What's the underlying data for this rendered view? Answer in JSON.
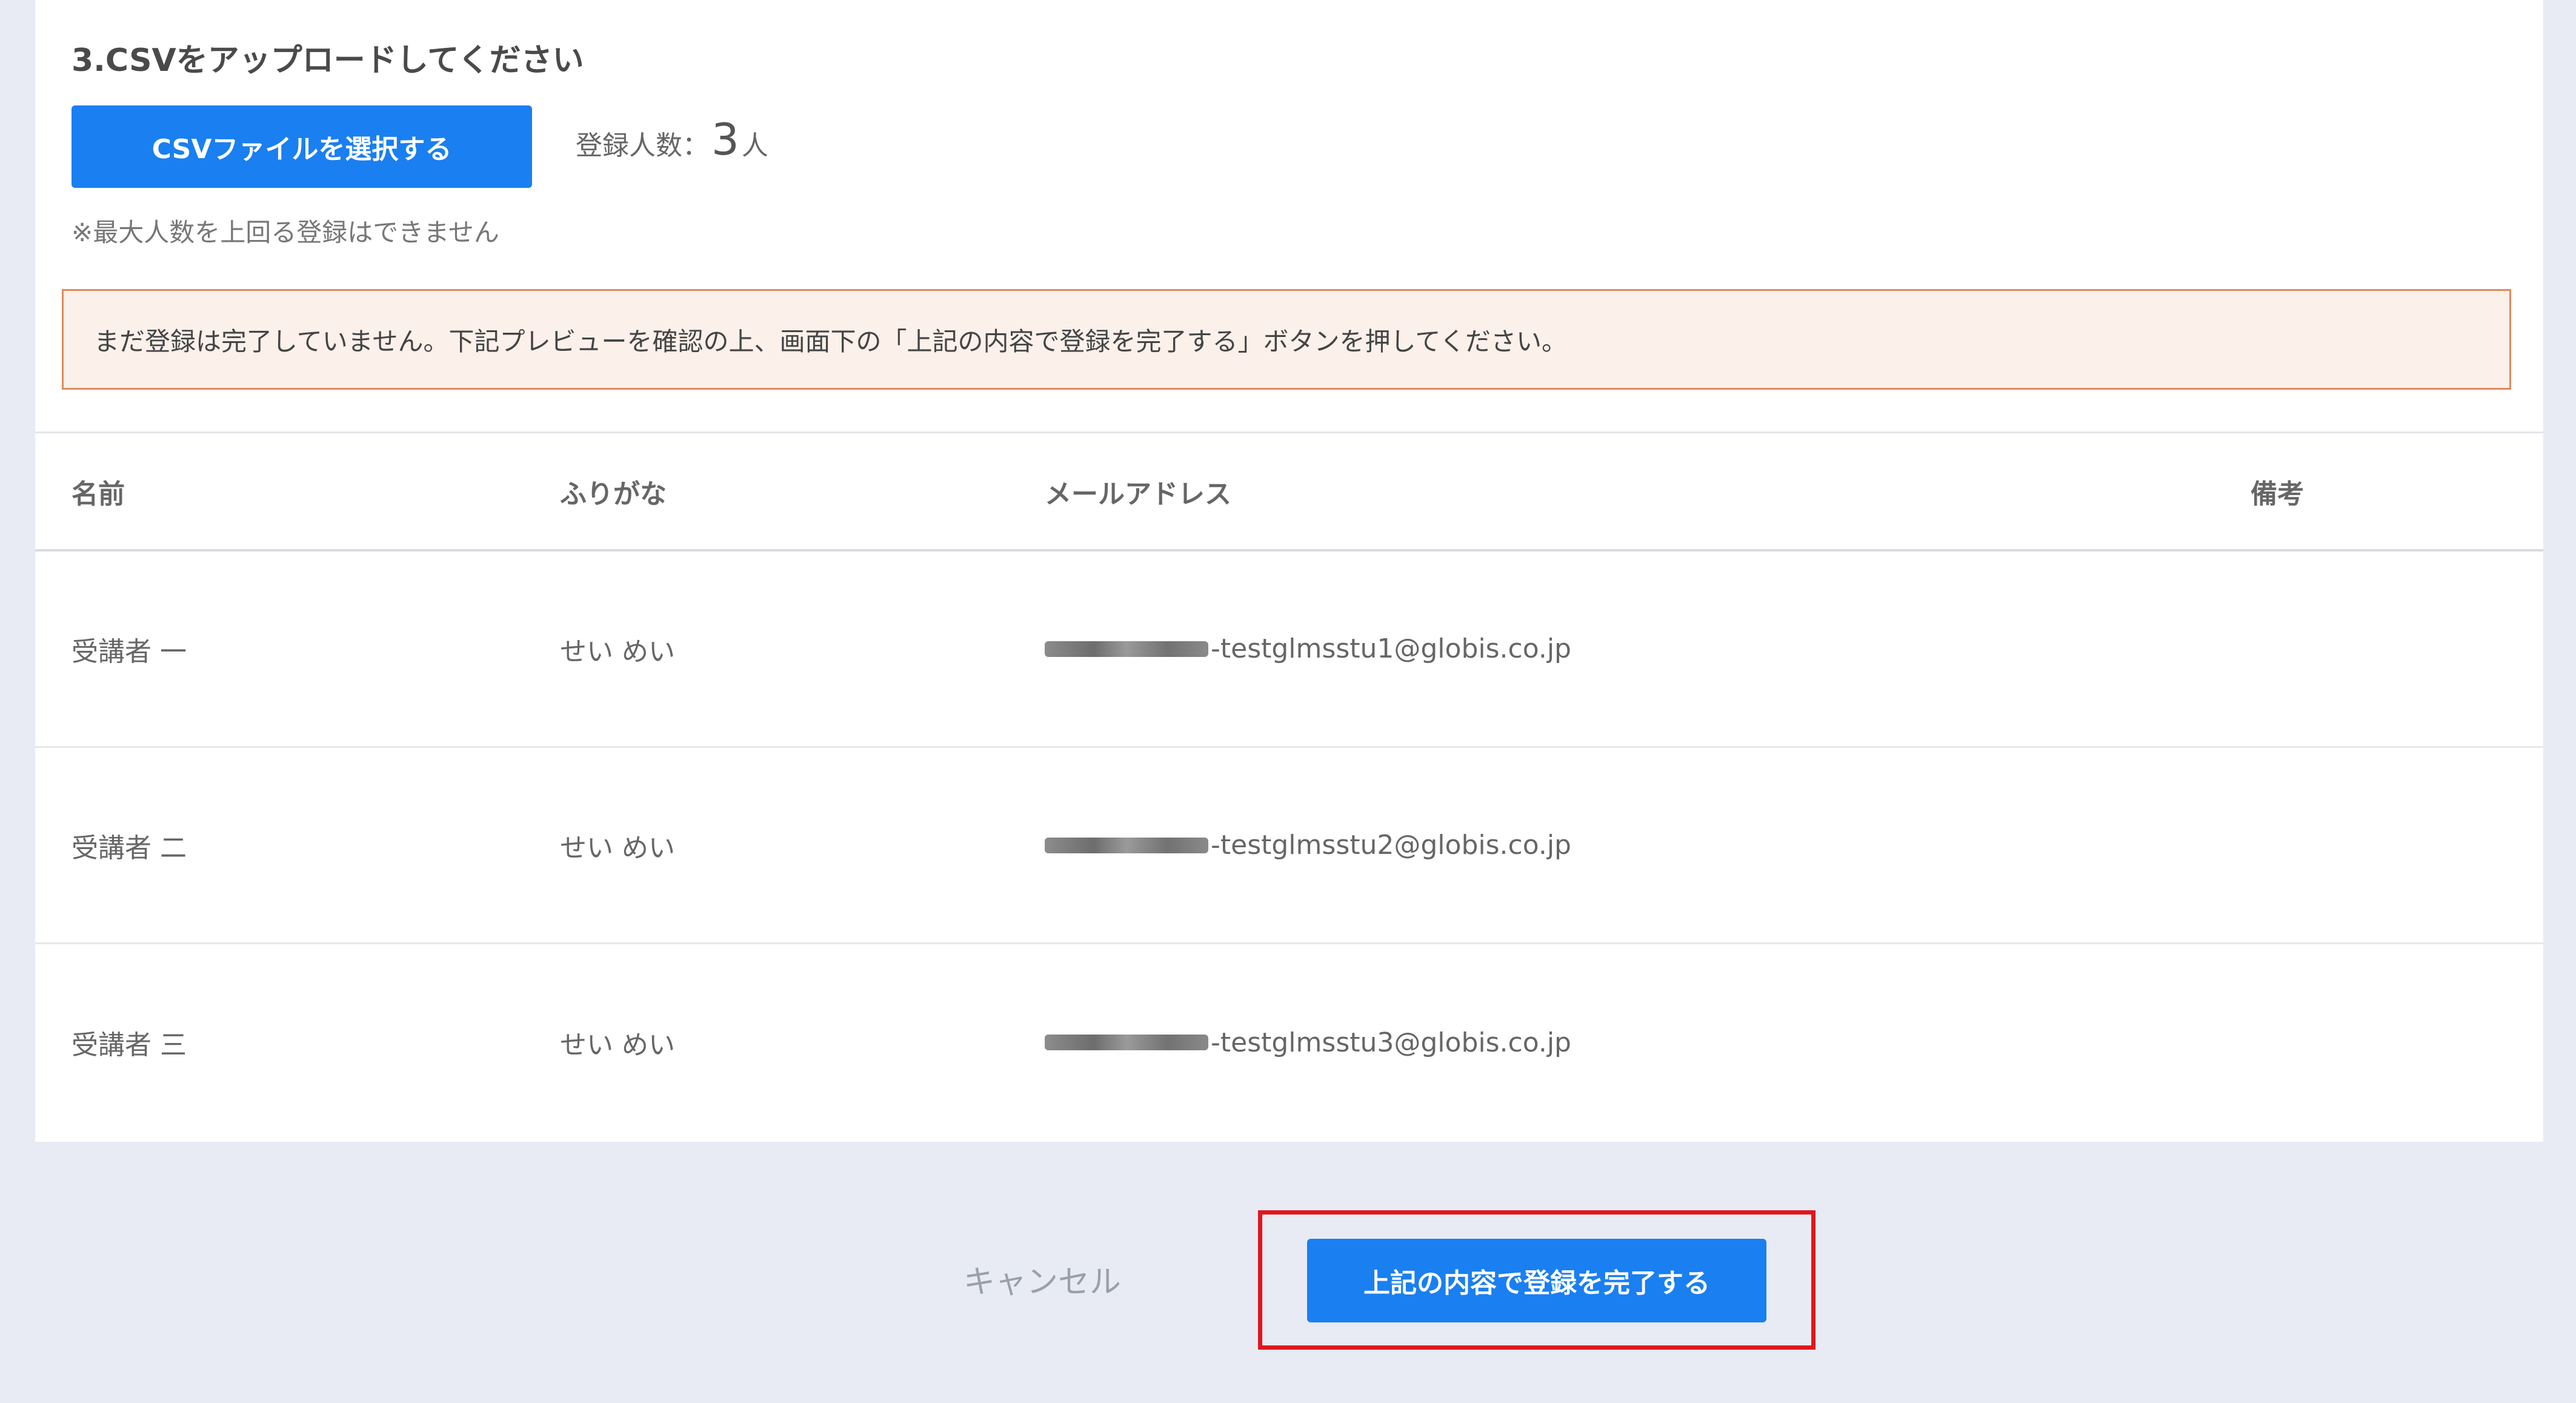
{
  "upload_section": {
    "title": "3.CSVをアップロードしてください",
    "select_button_label": "CSVファイルを選択する",
    "count_label": "登録人数：",
    "count_value": "3",
    "count_unit": "人",
    "limit_note": "※最大人数を上回る登録はできません"
  },
  "alert": {
    "message": "まだ登録は完了していません。下記プレビューを確認の上、画面下の「上記の内容で登録を完了する」ボタンを押してください。"
  },
  "table": {
    "headers": {
      "name": "名前",
      "furigana": "ふりがな",
      "email": "メールアドレス",
      "remarks": "備考"
    },
    "rows": [
      {
        "name": "受講者 一",
        "furigana": "せい めい",
        "email": "-testglmsstu1@globis.co.jp",
        "remarks": ""
      },
      {
        "name": "受講者 二",
        "furigana": "せい めい",
        "email": "-testglmsstu2@globis.co.jp",
        "remarks": ""
      },
      {
        "name": "受講者 三",
        "furigana": "せい めい",
        "email": "-testglmsstu3@globis.co.jp",
        "remarks": ""
      }
    ]
  },
  "footer": {
    "cancel_label": "キャンセル",
    "complete_button_label": "上記の内容で登録を完了する"
  },
  "colors": {
    "primary_button": "#1a7ff0",
    "alert_background": "#fbf0ea",
    "alert_border": "#e08a5e",
    "highlight_box": "#e3151d",
    "page_background": "#e8ebf3"
  }
}
